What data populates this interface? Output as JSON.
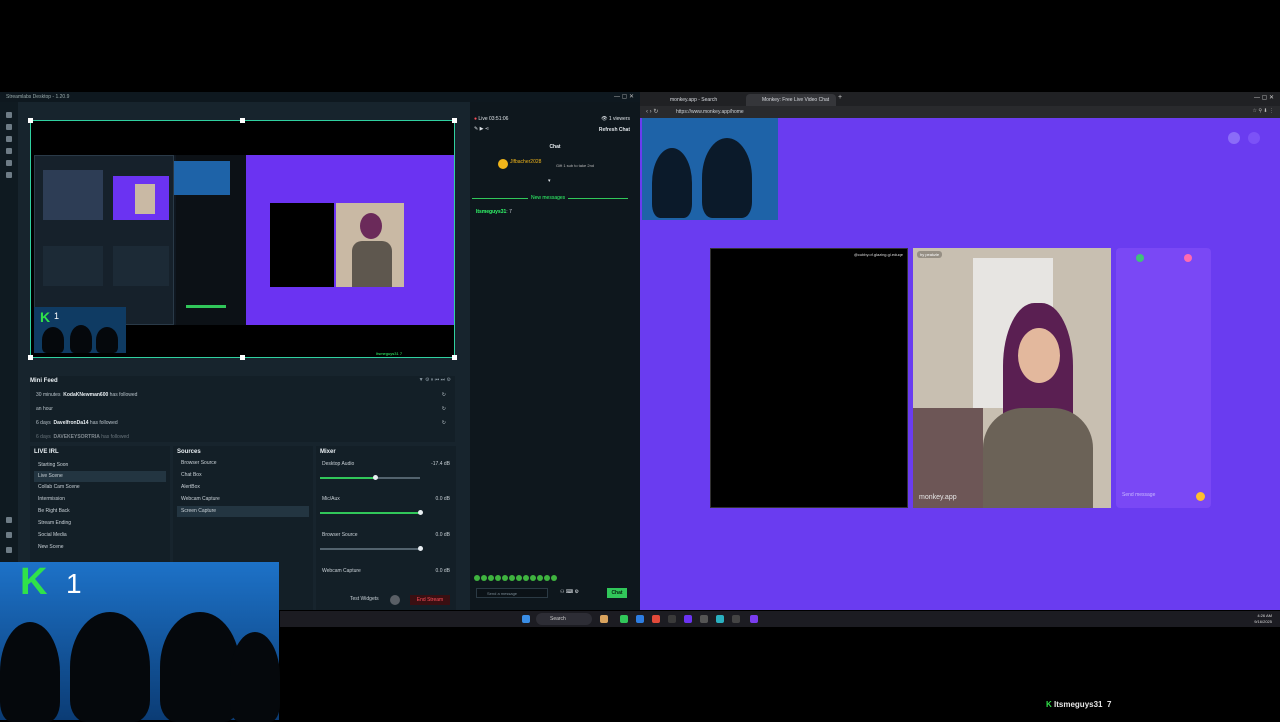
{
  "streamlabs": {
    "window_title": "Streamlabs Desktop - 1.20.9",
    "live_time": "Live 03:51:06",
    "viewers": "1 viewers",
    "refresh_chat": "Refresh Chat",
    "chat_title": "Chat",
    "top_donor": "Jlfbacher2028",
    "gift_note": "Gift 1 sub to take 2nd",
    "new_messages": "New messages",
    "chat_message_user": "Itsmeguys31",
    "chat_message_text": "7",
    "send_placeholder": "Send a message",
    "chat_button": "Chat",
    "mini_feed": {
      "title": "Mini Feed",
      "items": [
        {
          "time": "30 minutes",
          "user": "KodaKNewman600",
          "action": "has followed"
        },
        {
          "time": "an hour",
          "user": "",
          "action": ""
        },
        {
          "time": "6 days",
          "user": "DavelfronDa14",
          "action": "has followed"
        },
        {
          "time": "6 days",
          "user": "DAVEKEYSORTRIA",
          "action": "has followed"
        }
      ]
    },
    "scenes": {
      "title": "LIVE IRL",
      "items": [
        "Starting Soon",
        "Live Scene",
        "Collab Cam Scene",
        "Intermission",
        "Be Right Back",
        "Stream Ending",
        "Social Media",
        "New Scene"
      ],
      "selected": 1
    },
    "sources": {
      "title": "Sources",
      "items": [
        "Browser Source",
        "Chat Box",
        "AlertBox",
        "Webcam Capture",
        "Screen Capture"
      ],
      "selected": 4
    },
    "mixer": {
      "title": "Mixer",
      "channels": [
        {
          "name": "Desktop Audio",
          "db": "-17.4 dB",
          "level": 0.55
        },
        {
          "name": "Mic/Aux",
          "db": "0.0 dB",
          "level": 1.0
        },
        {
          "name": "Browser Source",
          "db": "0.0 dB",
          "level": 1.0
        },
        {
          "name": "Webcam Capture",
          "db": "0.0 dB",
          "level": 1.0
        }
      ]
    },
    "test_widgets": "Test Widgets",
    "end_stream": "End Stream"
  },
  "browser": {
    "tabs": [
      "monkey.app - Search",
      "Monkey: Free Live Video Chat"
    ],
    "url": "https://www.monkey.app/home",
    "black_label": "@cubby.of.glazing.gl.eduqe",
    "cam_label": "hy peakzie",
    "brand": "monkey.app",
    "send_message": "Send message"
  },
  "taskbar": {
    "search": "Search",
    "time": "4:26 AM",
    "date": "9/16/2025"
  },
  "overlay": {
    "k_letter": "K",
    "k_number": "1",
    "bottom_user": "Itsmeguys31",
    "bottom_count": "7"
  }
}
